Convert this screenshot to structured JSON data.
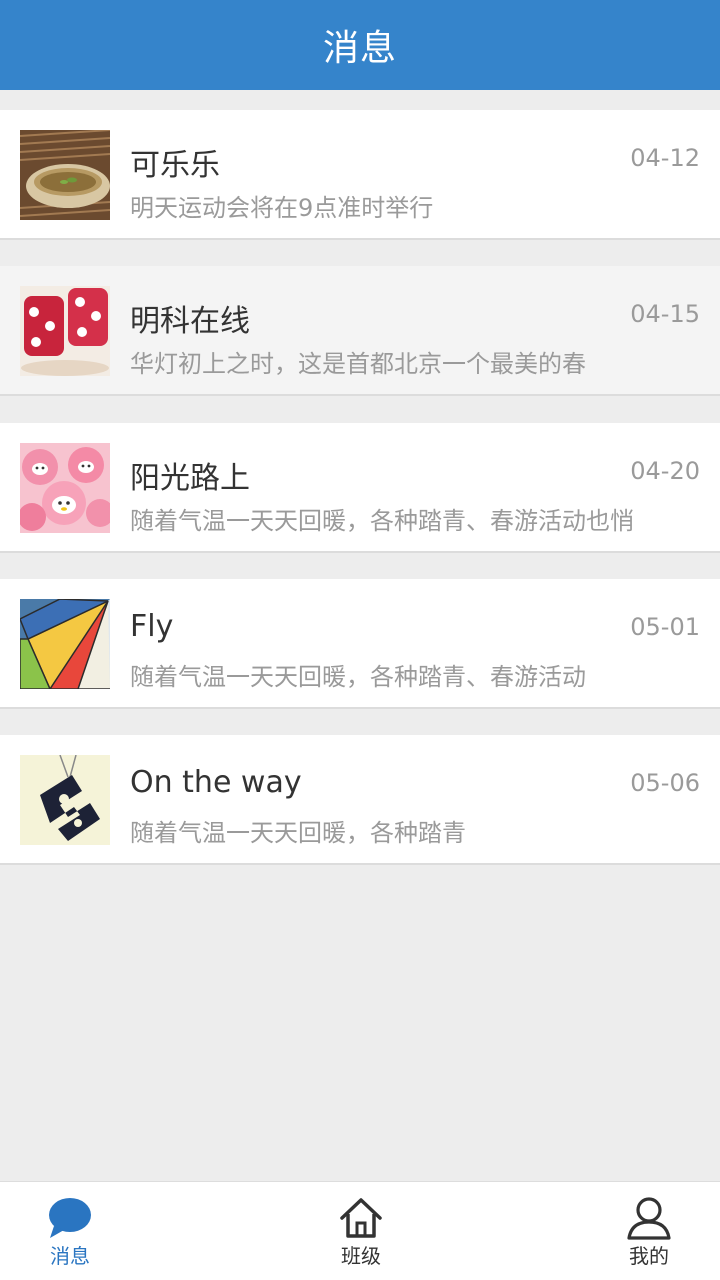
{
  "header": {
    "title": "消息"
  },
  "messages": [
    {
      "title": "可乐乐",
      "preview": "明天运动会将在9点准时举行",
      "date": "04-12",
      "thumb": "tea-cup-thumbnail"
    },
    {
      "title": "明科在线",
      "preview": "华灯初上之时，这是首都北京一个最美的春",
      "date": "04-15",
      "thumb": "polka-dot-cups-thumbnail"
    },
    {
      "title": "阳光路上",
      "preview": "随着气温一天天回暖，各种踏青、春游活动也悄",
      "date": "04-20",
      "thumb": "pink-candy-thumbnail"
    },
    {
      "title": "Fly",
      "preview": "随着气温一天天回暖，各种踏青、春游活动",
      "date": "05-01",
      "thumb": "parachute-thumbnail"
    },
    {
      "title": "On the way",
      "preview": "随着气温一天天回暖，各种踏青",
      "date": "05-06",
      "thumb": "pendant-thumbnail"
    }
  ],
  "tabbar": {
    "active": "messages",
    "tabs": [
      {
        "id": "messages",
        "label": "消息",
        "icon": "chat-bubble-icon"
      },
      {
        "id": "class",
        "label": "班级",
        "icon": "home-icon"
      },
      {
        "id": "me",
        "label": "我的",
        "icon": "person-icon"
      }
    ]
  },
  "colors": {
    "header_bg": "#3584cb",
    "accent": "#2a75c1",
    "page_bg": "#ededed",
    "secondary_text": "#9a9a9a"
  }
}
